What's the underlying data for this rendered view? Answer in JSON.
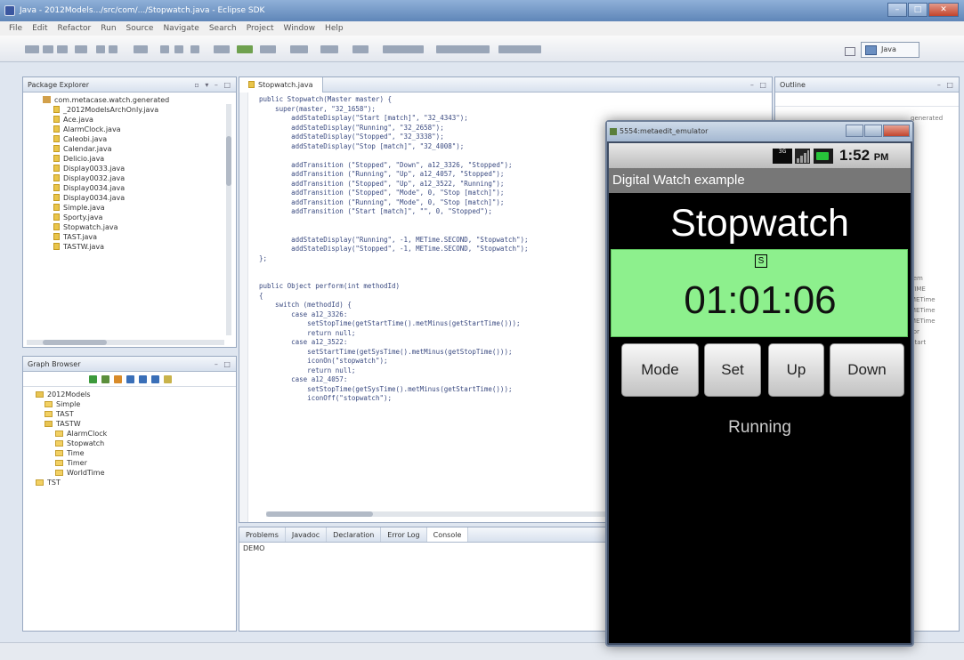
{
  "eclipse": {
    "title": "Java - 2012Models.../src/com/.../Stopwatch.java - Eclipse SDK",
    "menu": [
      "File",
      "Edit",
      "Refactor",
      "Run",
      "Source",
      "Navigate",
      "Search",
      "Project",
      "Window",
      "Help"
    ],
    "perspective_label": "Java"
  },
  "package_explorer": {
    "tab": "Package Explorer",
    "package": "com.metacase.watch.generated",
    "files": [
      "_2012ModelsArchOnly.java",
      "Ace.java",
      "AlarmClock.java",
      "Caleobi.java",
      "Calendar.java",
      "Delicio.java",
      "Display0033.java",
      "Display0032.java",
      "Display0034.java",
      "Display0034.java",
      "Simple.java",
      "Sporty.java",
      "Stopwatch.java",
      "TAST.java",
      "TASTW.java"
    ]
  },
  "graph_browser": {
    "tab": "Graph Browser",
    "root": "2012Models",
    "items": [
      "Simple",
      "TAST",
      "TASTW"
    ],
    "sub_items": [
      "AlarmClock",
      "Stopwatch",
      "Time",
      "Timer",
      "WorldTime"
    ],
    "last": "TST"
  },
  "editor": {
    "tab": "Stopwatch.java",
    "lines": [
      "public Stopwatch(Master master) {",
      "    super(master, \"32_1658\");",
      "        addStateDisplay(\"Start [match]\", \"32_4343\");",
      "        addStateDisplay(\"Running\", \"32_2658\");",
      "        addStateDisplay(\"Stopped\", \"32_3338\");",
      "        addStateDisplay(\"Stop [match]\", \"32_4008\");",
      "",
      "        addTransition (\"Stopped\", \"Down\", a12_3326, \"Stopped\");",
      "        addTransition (\"Running\", \"Up\", a12_4057, \"Stopped\");",
      "        addTransition (\"Stopped\", \"Up\", a12_3522, \"Running\");",
      "        addTransition (\"Stopped\", \"Mode\", 0, \"Stop [match]\");",
      "        addTransition (\"Running\", \"Mode\", 0, \"Stop [match]\");",
      "        addTransition (\"Start [match]\", \"\", 0, \"Stopped\");",
      "",
      "",
      "        addStateDisplay(\"Running\", -1, METime.SECOND, \"Stopwatch\");",
      "        addStateDisplay(\"Stopped\", -1, METime.SECOND, \"Stopwatch\");",
      "};",
      "",
      "",
      "public Object perform(int methodId)",
      "{",
      "    switch (methodId) {",
      "        case a12_3326:",
      "            setStopTime(getStartTime().metMinus(getStartTime()));",
      "            return null;",
      "        case a12_3522:",
      "            setStartTime(getSysTime().metMinus(getStopTime()));",
      "            iconOn(\"stopwatch\");",
      "            return null;",
      "        case a12_4057:",
      "            setStopTime(getSysTime().metMinus(getStartTime()));",
      "            iconOff(\"stopwatch\");"
    ]
  },
  "console": {
    "tabs": [
      "Problems",
      "Javadoc",
      "Declaration",
      "Error Log",
      "Console"
    ],
    "content": "DEMO"
  },
  "outline": {
    "tab": "Outline",
    "items": [
      "generated",
      "",
      "",
      "",
      "",
      "",
      "",
      "",
      "",
      "",
      "",
      "",
      "",
      "",
      "",
      "tem",
      "TIME",
      "METime",
      "METime",
      "METime",
      "tor",
      "Start"
    ]
  },
  "emulator": {
    "title": "5554:metaedit_emulator",
    "clock_time": "1:52",
    "clock_ampm": "PM",
    "network_label": "3G",
    "app_title": "Digital Watch example",
    "watch_title": "Stopwatch",
    "indicator": "S",
    "time": "01:01:06",
    "buttons": {
      "mode": "Mode",
      "set": "Set",
      "up": "Up",
      "down": "Down"
    },
    "status": "Running",
    "display_color": "#8df08d"
  }
}
